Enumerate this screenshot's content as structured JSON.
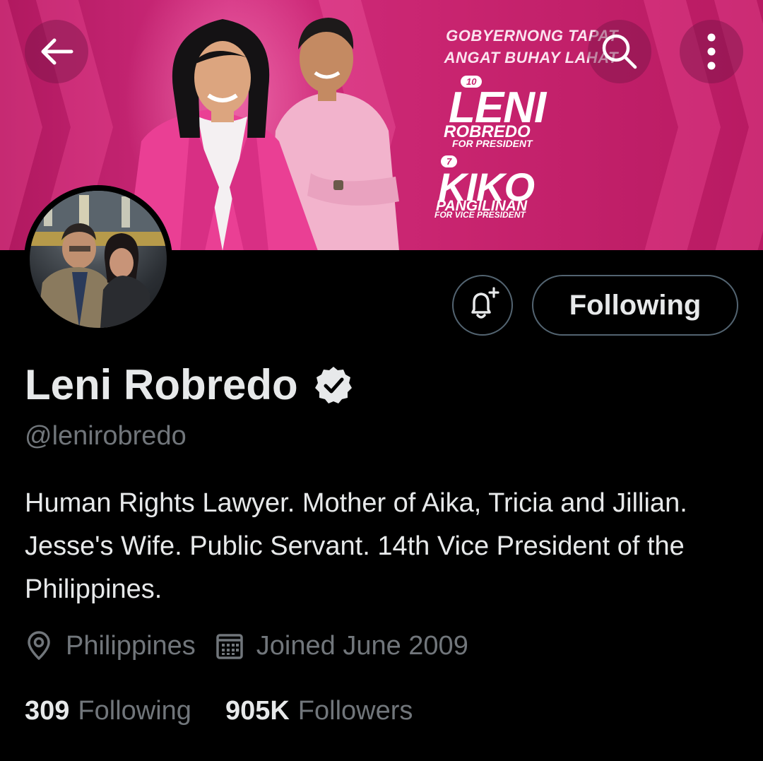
{
  "header": {
    "back_icon": "arrow-left-icon",
    "search_icon": "search-icon",
    "more_icon": "more-vertical-icon"
  },
  "banner": {
    "slogan_line1": "GOBYERNONG TAPAT",
    "slogan_line2": "ANGAT BUHAY LAHAT",
    "candidate1_number": "10",
    "candidate1_first": "LENI",
    "candidate1_last": "ROBREDO",
    "candidate1_role": "FOR PRESIDENT",
    "candidate2_number": "7",
    "candidate2_first": "KIKO",
    "candidate2_last": "PANGILINAN",
    "candidate2_role": "FOR VICE PRESIDENT",
    "colors": {
      "primary": "#c8246f",
      "light": "#ff8cc4"
    }
  },
  "profile": {
    "name": "Leni Robredo",
    "verified_icon": "verified-badge-icon",
    "handle": "@lenirobredo",
    "bio": "Human Rights Lawyer. Mother of Aika, Tricia and Jillian. Jesse's Wife. Public Servant. 14th Vice President of the Philippines.",
    "location": "Philippines",
    "location_icon": "location-pin-icon",
    "joined": "Joined June 2009",
    "joined_icon": "calendar-icon"
  },
  "actions": {
    "notify_icon": "bell-plus-icon",
    "follow_label": "Following"
  },
  "stats": {
    "following_count": "309",
    "following_label": "Following",
    "followers_count": "905K",
    "followers_label": "Followers"
  },
  "colors": {
    "background": "#000000",
    "text": "#e7e9ea",
    "secondary": "#71767b",
    "border": "#536471"
  }
}
